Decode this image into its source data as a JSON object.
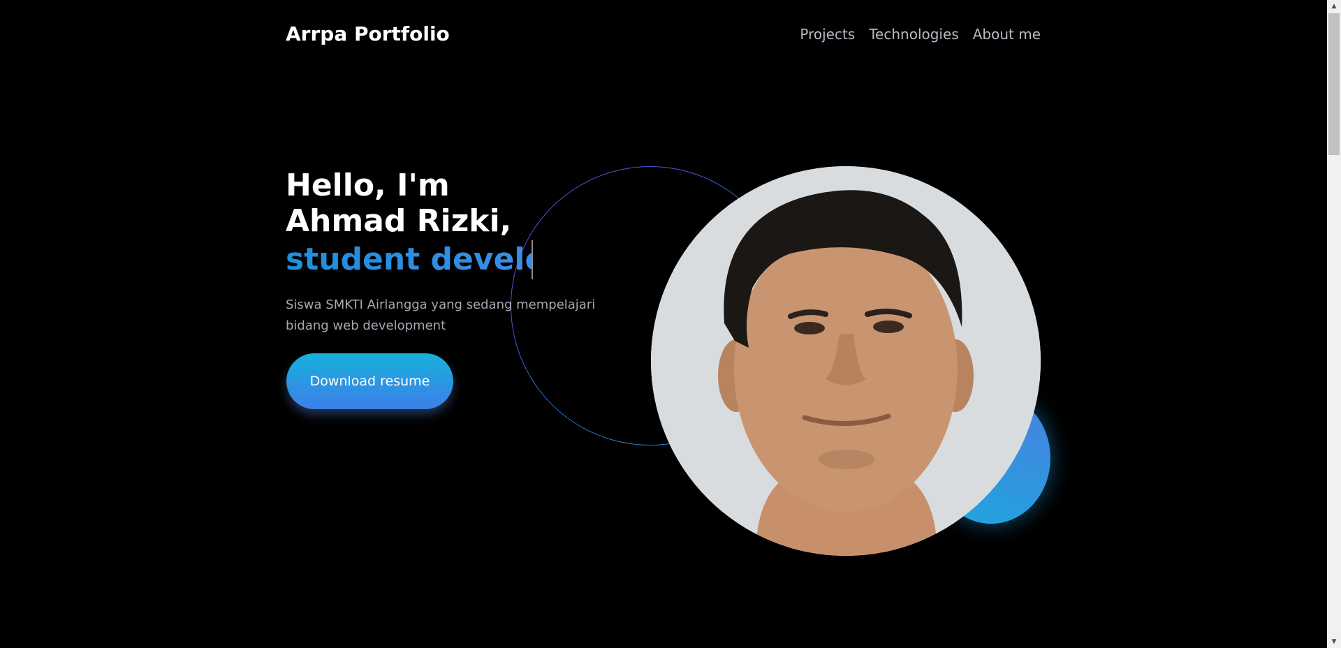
{
  "nav": {
    "brand": "Arrpa Portfolio",
    "links": [
      "Projects",
      "Technologies",
      "About me"
    ]
  },
  "hero": {
    "title": "Hello, I'm Ahmad Rizki,",
    "role": "student developer",
    "description": "Siswa SMKTI Airlangga yang sedang mempelajari bidang web development",
    "resume_button": "Download resume"
  },
  "colors": {
    "background": "#000000",
    "accent": "#2f8fe0",
    "button_gradient_start": "#17b1dc",
    "button_gradient_end": "#3d7fe8"
  },
  "icons": {
    "scroll_up": "scroll-up-arrow-icon",
    "scroll_down": "scroll-down-arrow-icon"
  }
}
